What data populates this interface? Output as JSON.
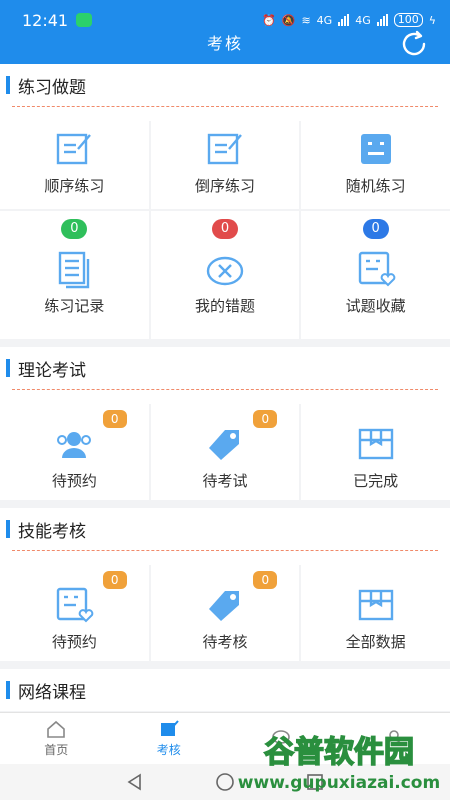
{
  "status": {
    "time": "12:41",
    "net_a": "4G",
    "net_b": "4G",
    "battery": "100"
  },
  "header": {
    "title": "考核"
  },
  "sections": {
    "practice": {
      "title": "练习做题",
      "items": [
        {
          "label": "顺序练习"
        },
        {
          "label": "倒序练习"
        },
        {
          "label": "随机练习"
        },
        {
          "label": "练习记录",
          "badge": "0"
        },
        {
          "label": "我的错题",
          "badge": "0"
        },
        {
          "label": "试题收藏",
          "badge": "0"
        }
      ]
    },
    "theory": {
      "title": "理论考试",
      "items": [
        {
          "label": "待预约",
          "badge": "0"
        },
        {
          "label": "待考试",
          "badge": "0"
        },
        {
          "label": "已完成"
        }
      ]
    },
    "skill": {
      "title": "技能考核",
      "items": [
        {
          "label": "待预约",
          "badge": "0"
        },
        {
          "label": "待考核",
          "badge": "0"
        },
        {
          "label": "全部数据"
        }
      ]
    },
    "online": {
      "title": "网络课程"
    }
  },
  "tabs": [
    {
      "label": "首页",
      "icon": "home-icon"
    },
    {
      "label": "考核",
      "icon": "exam-icon"
    },
    {
      "label": "",
      "icon": "message-icon"
    },
    {
      "label": "",
      "icon": "profile-icon"
    }
  ],
  "watermark": {
    "line1": "谷普软件园",
    "line2": "www.gupuxiazai.com"
  },
  "colors": {
    "primary": "#1f8ceb",
    "icon_light": "#5aa9ef",
    "badge_green": "#2fbf5b",
    "badge_red": "#e14b4b",
    "badge_blue": "#2d79e6",
    "badge_orange": "#f0a13a"
  }
}
